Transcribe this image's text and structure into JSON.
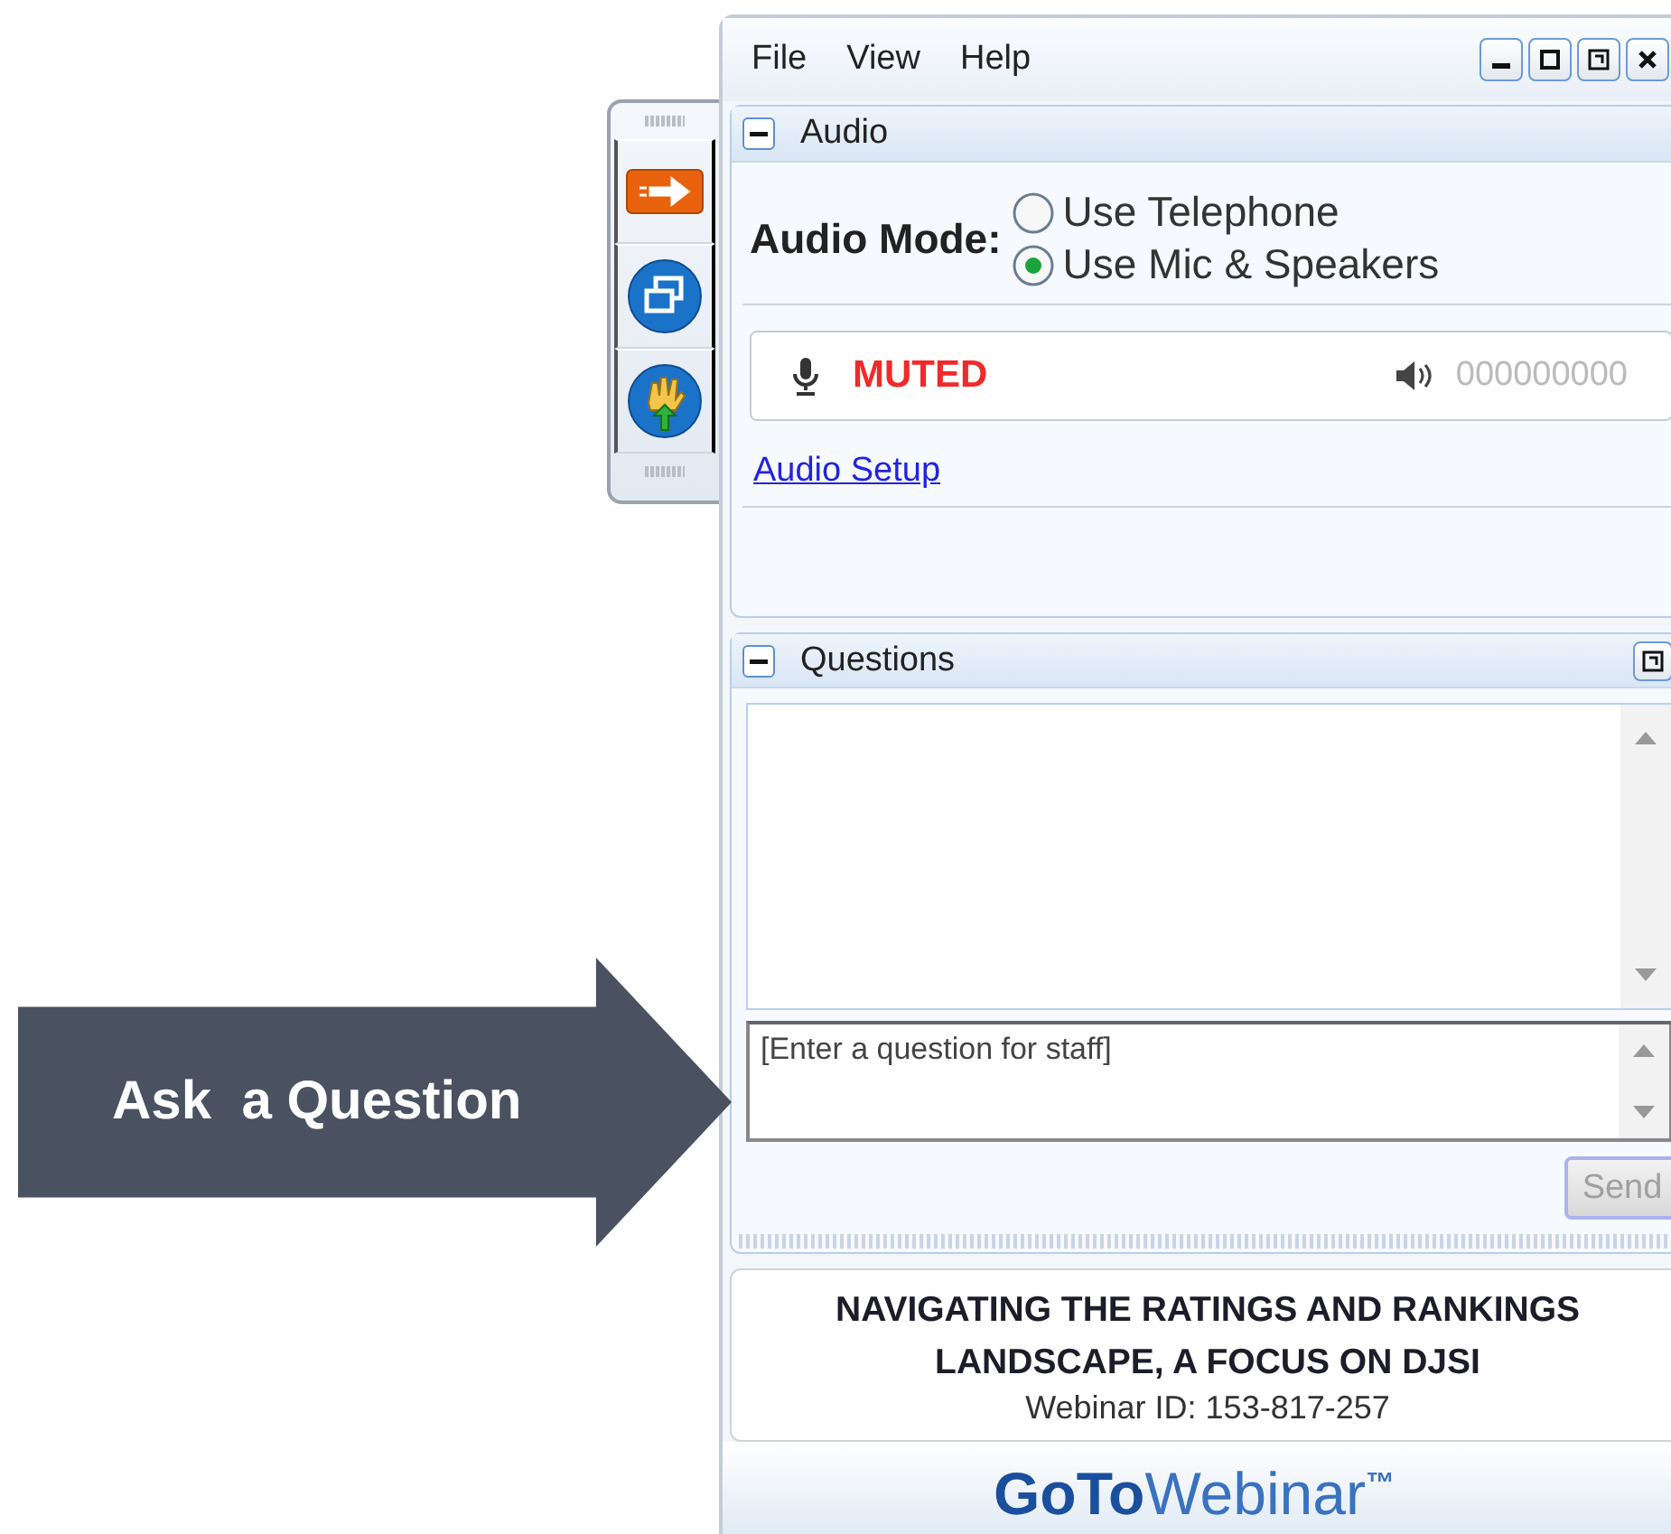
{
  "callout": {
    "text": "Ask  a Question"
  },
  "menu": [
    {
      "label": "File"
    },
    {
      "label": "View"
    },
    {
      "label": "Help"
    }
  ],
  "audio_panel": {
    "title": "Audio",
    "expanded": true,
    "mode_label": "Audio Mode:",
    "options": [
      {
        "label": "Use Telephone",
        "selected": false
      },
      {
        "label": "Use Mic & Speakers",
        "selected": true
      }
    ],
    "mic_status": "MUTED",
    "speaker_digits": "000000000",
    "setup_link": "Audio Setup"
  },
  "questions_panel": {
    "title": "Questions",
    "expanded": true,
    "input": {
      "placeholder": "[Enter a question for staff]"
    },
    "send_button": {
      "label": "Send",
      "disabled": true
    }
  },
  "webinar": {
    "title_lines": [
      "NAVIGATING THE RATINGS AND RANKINGS",
      "LANDSCAPE, A FOCUS ON DJSI"
    ],
    "id_text": "Webinar ID: 153-817-257"
  },
  "logo": {
    "bold": "GoTo",
    "light": "Webinar",
    "mark": "™"
  }
}
